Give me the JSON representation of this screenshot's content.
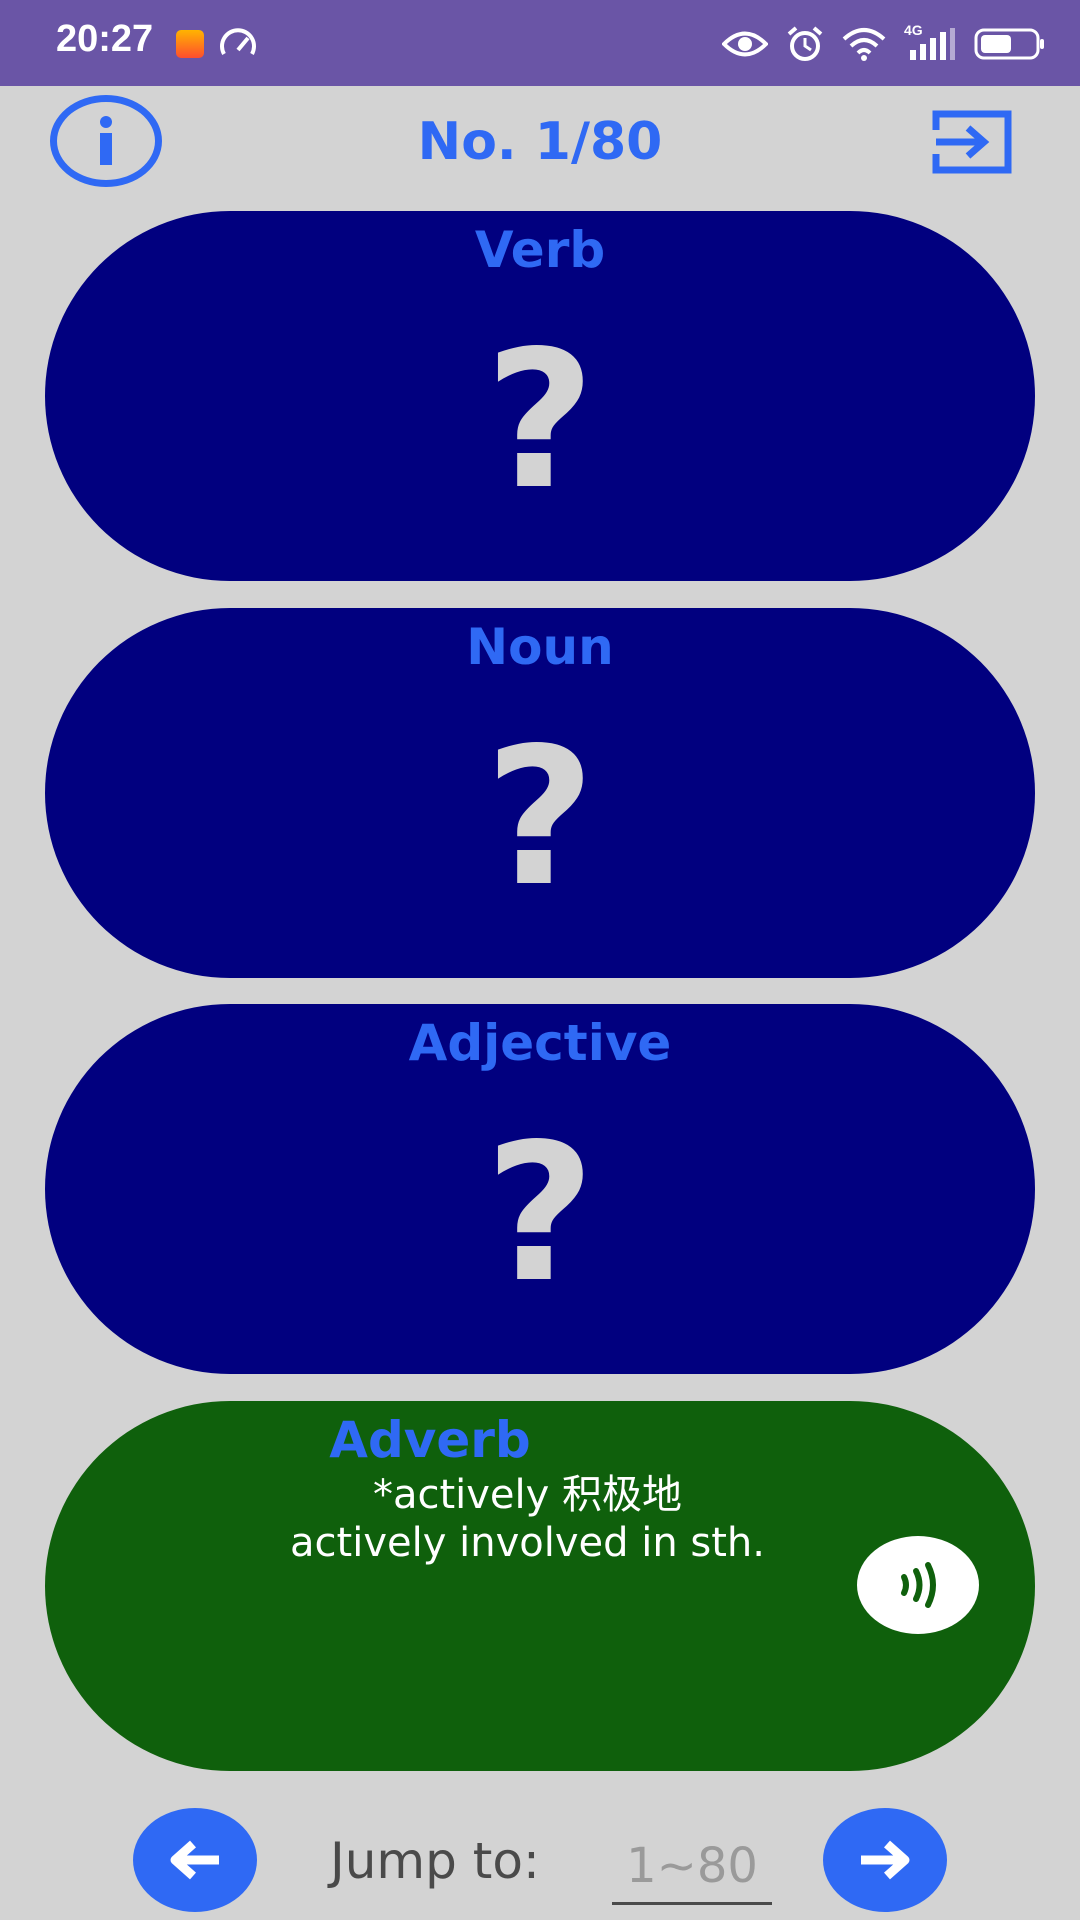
{
  "status_bar": {
    "time": "20:27",
    "network_label": "4G",
    "icons": [
      "app-notification-icon",
      "speed-meter-icon",
      "eye-icon",
      "alarm-icon",
      "wifi-icon",
      "signal-icon",
      "battery-icon"
    ]
  },
  "header": {
    "title": "No. 1/80",
    "info_icon_glyph": "i",
    "accent_color": "#2f69f4"
  },
  "cards": [
    {
      "label": "Verb",
      "content": "?",
      "color": "#01007f"
    },
    {
      "label": "Noun",
      "content": "?",
      "color": "#01007f"
    },
    {
      "label": "Adjective",
      "content": "?",
      "color": "#01007f"
    },
    {
      "label": "Adverb",
      "line1": "*actively 积极地",
      "line2": "actively involved in sth.",
      "color": "#0f600c"
    }
  ],
  "footer": {
    "jump_label": "Jump to:",
    "jump_placeholder": "1~80"
  }
}
